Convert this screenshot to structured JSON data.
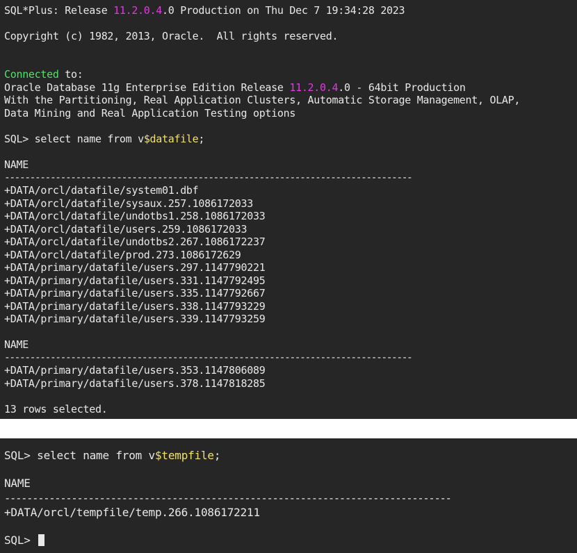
{
  "colors": {
    "background": "#262626",
    "text": "#e8e8e8",
    "number_highlight": "#e536e5",
    "variable_highlight": "#f2e26a",
    "keyword_highlight": "#4fe36a"
  },
  "terminal1": {
    "banner": {
      "prefix": "SQL*Plus: Release ",
      "version_major": "11.2.0.4",
      "version_minor": ".0",
      "suffix": " Production on Thu Dec 7 19:34:28 2023"
    },
    "copyright": "Copyright (c) 1982, 2013, Oracle.  All rights reserved.",
    "connected_word": "Connected",
    "connected_rest": " to:",
    "db_line": {
      "prefix": "Oracle Database 11g Enterprise Edition Release ",
      "version": "11.2.0.4",
      "suffix": ".0 - 64bit Production"
    },
    "options_line1": "With the Partitioning, Real Application Clusters, Automatic Storage Management, OLAP,",
    "options_line2": "Data Mining and Real Application Testing options",
    "query": {
      "prefix": "SQL> select name from v",
      "variable": "$datafile",
      "suffix": ";"
    },
    "column_header": "NAME",
    "separator": "--------------------------------------------------------------------------------",
    "rows_page1": [
      "+DATA/orcl/datafile/system01.dbf",
      "+DATA/orcl/datafile/sysaux.257.1086172033",
      "+DATA/orcl/datafile/undotbs1.258.1086172033",
      "+DATA/orcl/datafile/users.259.1086172033",
      "+DATA/orcl/datafile/undotbs2.267.1086172237",
      "+DATA/orcl/datafile/prod.273.1086172629",
      "+DATA/primary/datafile/users.297.1147790221",
      "+DATA/primary/datafile/users.331.1147792495",
      "+DATA/primary/datafile/users.335.1147792667",
      "+DATA/primary/datafile/users.338.1147793229",
      "+DATA/primary/datafile/users.339.1147793259"
    ],
    "column_header_2": "NAME",
    "separator_2": "--------------------------------------------------------------------------------",
    "rows_page2": [
      "+DATA/primary/datafile/users.353.1147806089",
      "+DATA/primary/datafile/users.378.1147818285"
    ],
    "rows_selected": "13 rows selected."
  },
  "terminal2": {
    "query": {
      "prefix": "SQL> select name from v",
      "variable": "$tempfile",
      "suffix": ";"
    },
    "column_header": "NAME",
    "separator": "--------------------------------------------------------------------------------",
    "rows": [
      "+DATA/orcl/tempfile/temp.266.1086172211"
    ],
    "prompt": "SQL> "
  }
}
